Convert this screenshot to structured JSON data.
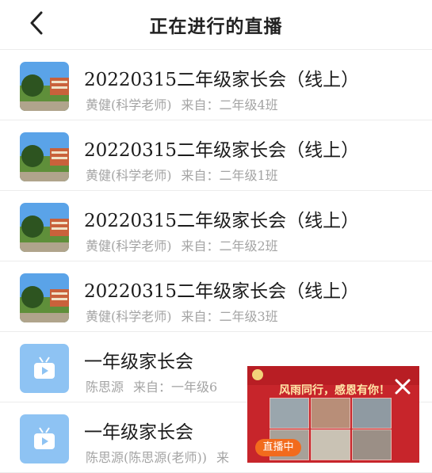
{
  "nav": {
    "title": "正在进行的直播"
  },
  "list": [
    {
      "title": "20220315二年级家长会（线上）",
      "teacher": "黄健(科学老师)",
      "source": "来自：二年级4班",
      "thumb": "photo"
    },
    {
      "title": "20220315二年级家长会（线上）",
      "teacher": "黄健(科学老师)",
      "source": "来自：二年级1班",
      "thumb": "photo"
    },
    {
      "title": "20220315二年级家长会（线上）",
      "teacher": "黄健(科学老师)",
      "source": "来自：二年级2班",
      "thumb": "photo"
    },
    {
      "title": "20220315二年级家长会（线上）",
      "teacher": "黄健(科学老师)",
      "source": "来自：二年级3班",
      "thumb": "photo"
    },
    {
      "title": "一年级家长会",
      "teacher": "陈思源",
      "source": "来自：一年级6",
      "thumb": "tv-icon"
    },
    {
      "title": "一年级家长会",
      "teacher": "陈思源(陈思源(老师))",
      "source": "来",
      "thumb": "tv-icon"
    }
  ],
  "pip": {
    "heading": "风雨同行，感恩有你！",
    "live_label": "直播中"
  },
  "colors": {
    "icon_blue": "#8ec3f3",
    "live_orange": "#f26b1d",
    "pip_red": "#c7252b"
  }
}
